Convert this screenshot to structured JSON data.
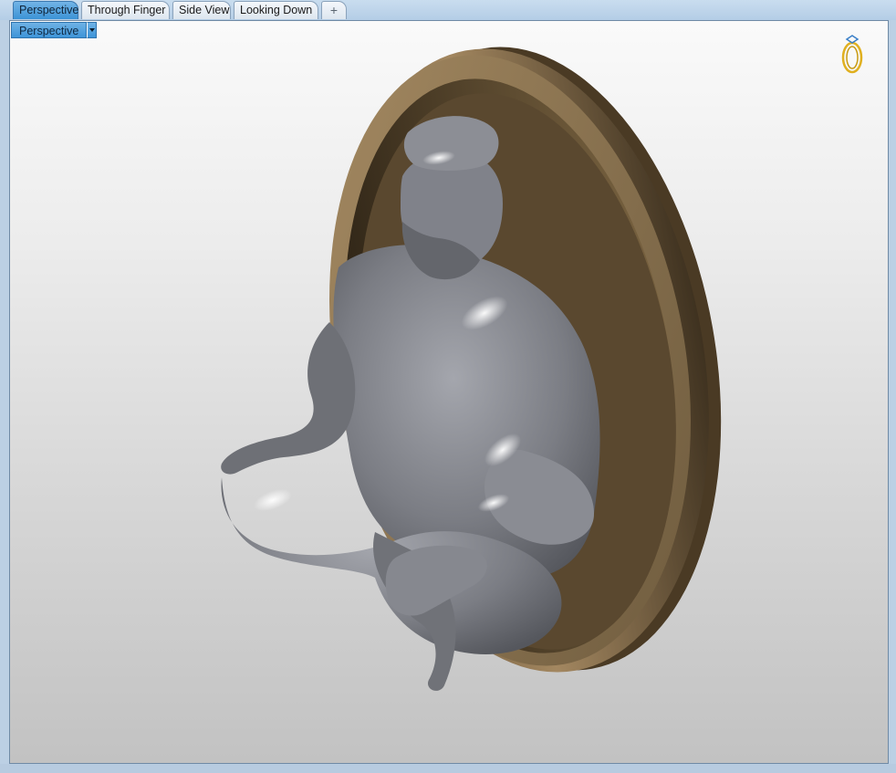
{
  "tabs": [
    {
      "label": "Perspective",
      "active": true
    },
    {
      "label": "Through Finger",
      "active": false
    },
    {
      "label": "Side View",
      "active": false
    },
    {
      "label": "Looking Down",
      "active": false
    }
  ],
  "add_tab_glyph": "+",
  "viewport": {
    "title": "Perspective",
    "dropdown_icon": "chevron-down-icon",
    "widget_icon": "ring-icon"
  },
  "scene": {
    "subject": "seated-figure-relief",
    "plaque_color": "#8e7450",
    "figure_color": "#7b7d84"
  },
  "colors": {
    "active_tab": "#3c93d6",
    "frame": "#bcd0e4",
    "ring_widget": "#e0b020"
  }
}
